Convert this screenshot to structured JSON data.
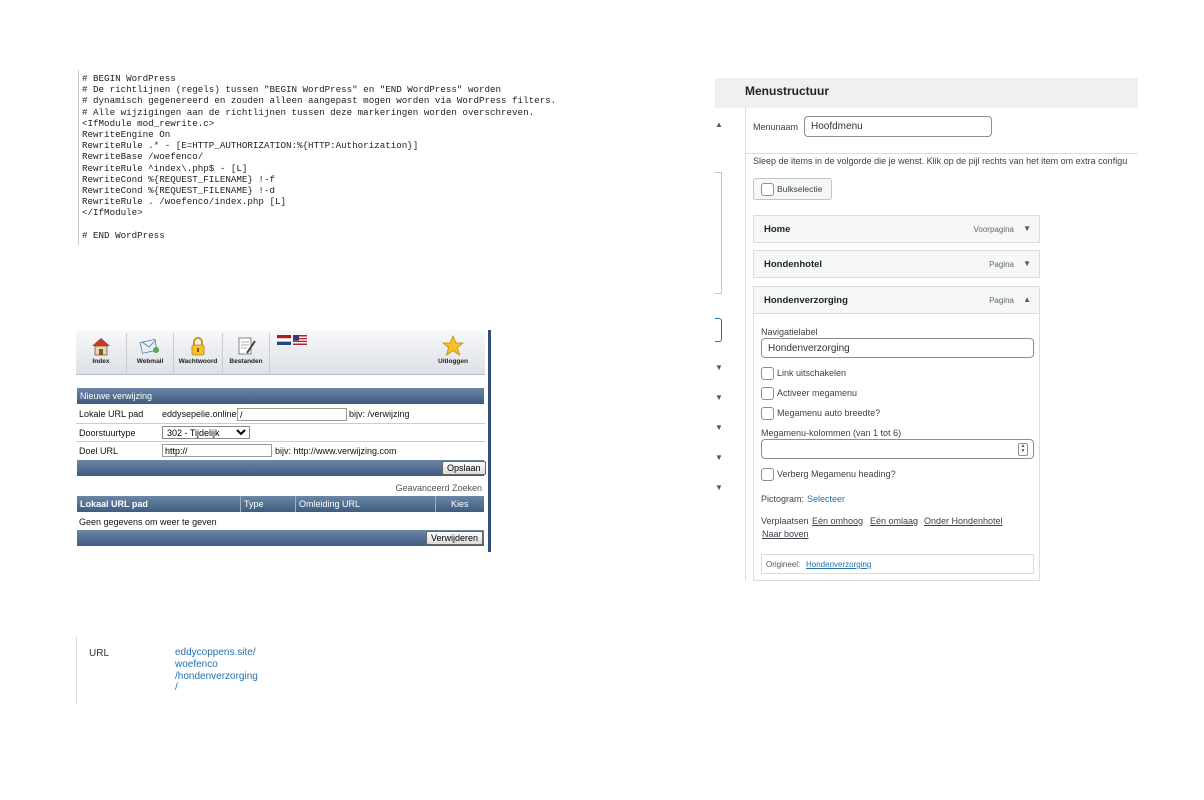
{
  "htaccess": {
    "lines": [
      "# BEGIN WordPress",
      "# De richtlijnen (regels) tussen \"BEGIN WordPress\" en \"END WordPress\" worden",
      "# dynamisch gegenereerd en zouden alleen aangepast mogen worden via WordPress filters.",
      "# Alle wijzigingen aan de richtlijnen tussen deze markeringen worden overschreven.",
      "<IfModule mod_rewrite.c>",
      "RewriteEngine On",
      "RewriteRule .* - [E=HTTP_AUTHORIZATION:%{HTTP:Authorization}]",
      "RewriteBase /woefenco/",
      "RewriteRule ^index\\.php$ - [L]",
      "RewriteCond %{REQUEST_FILENAME} !-f",
      "RewriteCond %{REQUEST_FILENAME} !-d",
      "RewriteRule . /woefenco/index.php [L]",
      "</IfModule>",
      "",
      "# END WordPress"
    ]
  },
  "directadmin": {
    "toolbar": {
      "index": "Index",
      "webmail": "Webmail",
      "password": "Wachtwoord",
      "files": "Bestanden",
      "logout": "Uitloggen"
    },
    "section_title": "Nieuwe verwijzing",
    "local_url_label": "Lokale URL pad",
    "domain_prefix": "eddysepelie.online",
    "local_url_value": "/",
    "local_url_example": "bijv: /verwijzing",
    "redirect_type_label": "Doorstuurtype",
    "redirect_type_value": "302 - Tijdelijk",
    "target_url_label": "Doel URL",
    "target_url_value": "http://",
    "target_url_example": "bijv: http://www.verwijzing.com",
    "save_button": "Opslaan",
    "advanced_search": "Geavanceerd Zoeken",
    "table_headers": [
      "Lokaal URL pad",
      "Type",
      "Omleiding URL",
      "Kies"
    ],
    "empty_message": "Geen gegevens om weer te geven",
    "delete_button": "Verwijderen"
  },
  "url_box": {
    "label": "URL",
    "value_lines": [
      "eddycoppens.site/",
      "woefenco",
      "/hondenverzorging",
      "/"
    ]
  },
  "wp_menu": {
    "title": "Menustructuur",
    "menu_name_label": "Menunaam",
    "menu_name_value": "Hoofdmenu",
    "instructions": "Sleep de items in de volgorde die je wenst. Klik op de pijl rechts van het item om extra configu",
    "bulk_select": "Bulkselectie",
    "items": [
      {
        "name": "Home",
        "type": "Voorpagina"
      },
      {
        "name": "Hondenhotel",
        "type": "Pagina"
      },
      {
        "name": "Hondenverzorging",
        "type": "Pagina"
      }
    ],
    "nav_label_label": "Navigatielabel",
    "nav_label_value": "Hondenverzorging",
    "cb_disable_link": "Link uitschakelen",
    "cb_megamenu": "Activeer megamenu",
    "cb_megamenu_auto": "Megamenu auto breedte?",
    "columns_label": "Megamenu-kolommen (van 1 tot 6)",
    "cb_hide_heading": "Verberg Megamenu heading?",
    "icon_label": "Pictogram:",
    "icon_link": "Selecteer",
    "move_label": "Verplaatsen",
    "move_up": "Eén omhoog",
    "move_down": "Eén omlaag",
    "move_under": "Onder Hondenhotel",
    "move_top": "Naar boven",
    "original_label": "Origineel:",
    "original_link": "Hondenverzorging"
  }
}
